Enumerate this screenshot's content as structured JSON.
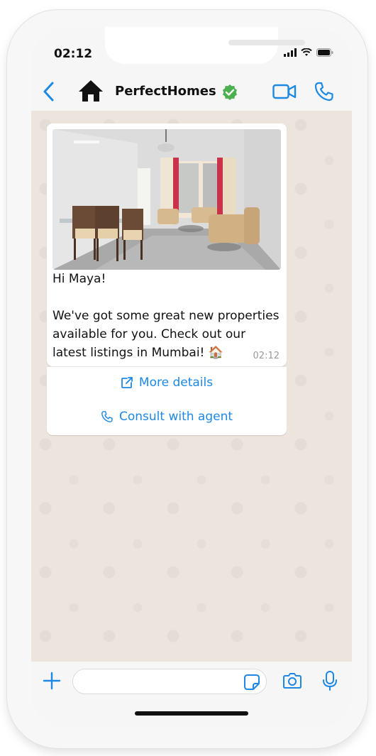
{
  "status_bar": {
    "time": "02:12"
  },
  "header": {
    "contact_name": "PerfectHomes",
    "accent_color": "#1e88e5",
    "verified_color": "#4caf50",
    "icons": [
      "chevron-left-icon",
      "home-icon",
      "verified-badge-icon",
      "video-call-icon",
      "phone-icon"
    ]
  },
  "message": {
    "image": "living-room-photo",
    "text": "Hi Maya!\n\nWe've got some great new properties available for you. Check out our latest listings in Mumbai! 🏠",
    "time": "02:12"
  },
  "actions": [
    {
      "label": "More details",
      "icon": "external-link-icon"
    },
    {
      "label": "Consult with agent",
      "icon": "phone-icon"
    }
  ],
  "composer": {
    "placeholder": "",
    "icons": [
      "plus-icon",
      "sticker-icon",
      "camera-icon",
      "mic-icon"
    ]
  }
}
